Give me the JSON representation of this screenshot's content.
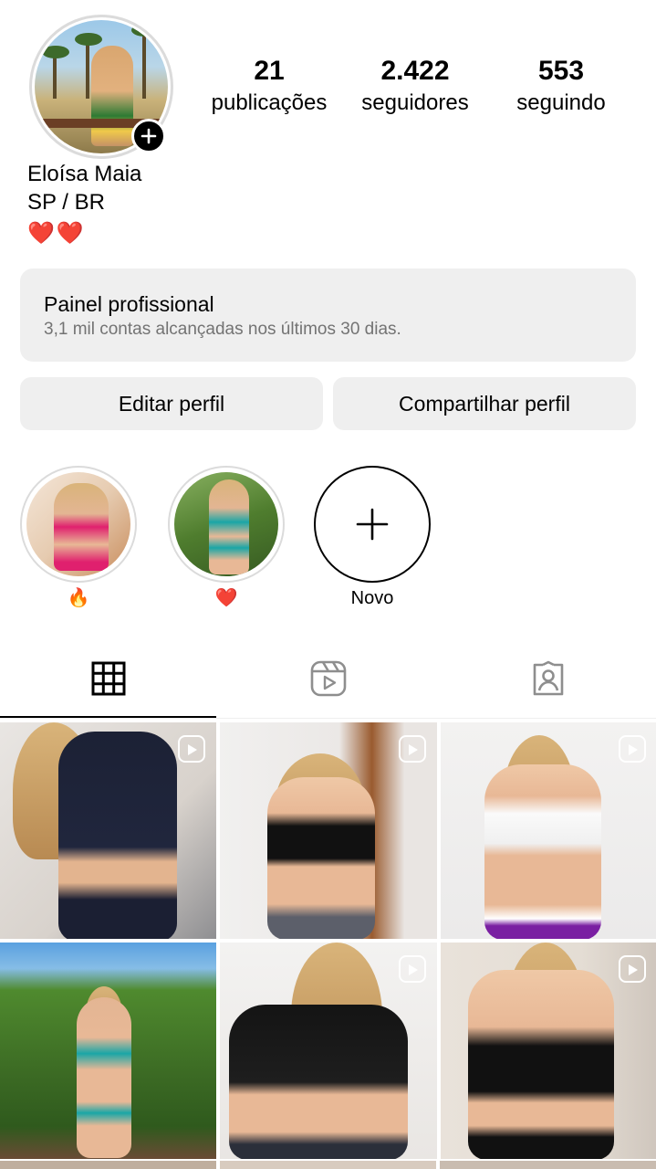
{
  "profile": {
    "name": "Eloísa Maia",
    "bio_location": "SP / BR",
    "bio_emojis": "❤️❤️",
    "add_story_icon": "plus-icon",
    "stats": [
      {
        "value": "21",
        "label": "publicações"
      },
      {
        "value": "2.422",
        "label": "seguidores"
      },
      {
        "value": "553",
        "label": "seguindo"
      }
    ]
  },
  "dashboard": {
    "title": "Painel profissional",
    "subtitle": "3,1 mil contas alcançadas nos últimos 30 dias."
  },
  "actions": {
    "edit_label": "Editar perfil",
    "share_label": "Compartilhar perfil"
  },
  "highlights": [
    {
      "caption": "🔥"
    },
    {
      "caption": "❤️"
    },
    {
      "caption": "Novo",
      "icon": "plus-icon"
    }
  ],
  "tabs": [
    {
      "name": "posts",
      "icon": "grid-icon",
      "active": true
    },
    {
      "name": "reels",
      "icon": "reels-icon",
      "active": false
    },
    {
      "name": "tagged",
      "icon": "tagged-person-icon",
      "active": false
    }
  ],
  "posts": [
    {
      "type": "reel",
      "icon": "reel-icon"
    },
    {
      "type": "reel",
      "icon": "reel-icon"
    },
    {
      "type": "reel",
      "icon": "reel-icon"
    },
    {
      "type": "photo"
    },
    {
      "type": "reel",
      "icon": "reel-icon"
    },
    {
      "type": "reel",
      "icon": "reel-icon"
    }
  ]
}
